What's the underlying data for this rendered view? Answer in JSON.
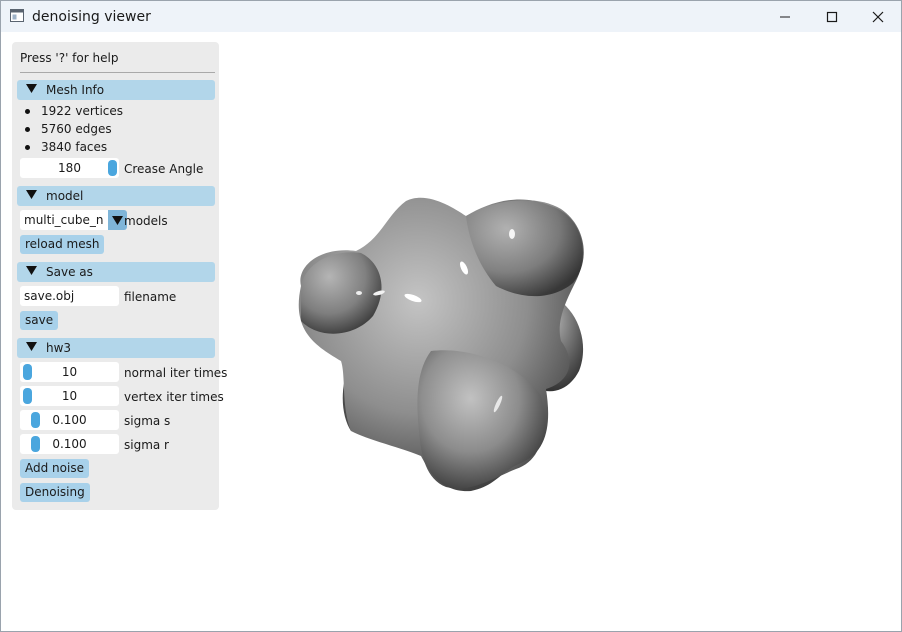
{
  "window": {
    "title": "denoising viewer"
  },
  "panel": {
    "help_text": "Press '?' for help",
    "mesh_info": {
      "header": "Mesh Info",
      "stats": [
        "1922 vertices",
        "5760 edges",
        "3840 faces"
      ],
      "crease_angle": {
        "value": "180",
        "label": "Crease Angle",
        "fraction": 1.0
      }
    },
    "model": {
      "header": "model",
      "selected": "multi_cube_noise",
      "label": "models",
      "reload_button": "reload mesh"
    },
    "save_as": {
      "header": "Save as",
      "filename_value": "save.obj",
      "filename_label": "filename",
      "save_button": "save"
    },
    "hw3": {
      "header": "hw3",
      "params": [
        {
          "value": "10",
          "label": "normal iter times",
          "fraction": 0.0
        },
        {
          "value": "10",
          "label": "vertex iter times",
          "fraction": 0.0
        },
        {
          "value": "0.100",
          "label": "sigma s",
          "fraction": 0.1
        },
        {
          "value": "0.100",
          "label": "sigma r",
          "fraction": 0.1
        }
      ],
      "add_noise_button": "Add noise",
      "denoise_button": "Denoising"
    }
  },
  "colors": {
    "header_bg": "#b2d6ea",
    "button_bg": "#a8d1ea",
    "slider_handle": "#4aa6de",
    "panel_bg": "#ebebeb"
  },
  "icons": {
    "collapse": "triangle-down-icon",
    "combo": "triangle-down-icon",
    "window_controls": [
      "minimize-icon",
      "maximize-icon",
      "close-icon"
    ]
  }
}
